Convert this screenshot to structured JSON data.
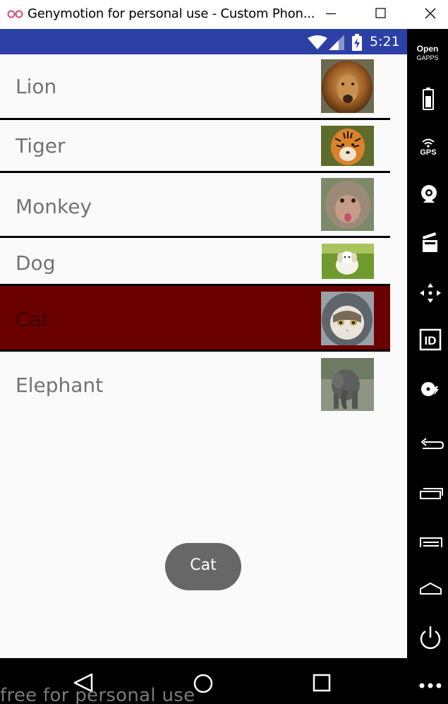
{
  "window": {
    "title": "Genymotion for personal use - Custom Phon...",
    "logo_icon": "genymotion-logo-icon",
    "controls": [
      "minimize-icon",
      "maximize-icon",
      "close-icon"
    ]
  },
  "statusbar": {
    "time": "5:21",
    "icons": [
      "wifi-icon",
      "signal-icon",
      "battery-charging-icon"
    ],
    "color": "#2c3fa5"
  },
  "list": {
    "items": [
      {
        "label": "Lion",
        "image": "lion-image"
      },
      {
        "label": "Tiger",
        "image": "tiger-image"
      },
      {
        "label": "Monkey",
        "image": "monkey-image"
      },
      {
        "label": "Dog",
        "image": "dog-image"
      },
      {
        "label": "Cat",
        "image": "cat-image",
        "selected": true
      },
      {
        "label": "Elephant",
        "image": "elephant-image"
      }
    ],
    "selected_color": "#6a0000"
  },
  "toast": {
    "text": "Cat"
  },
  "toolbar": {
    "open_gapps_line1": "Open",
    "open_gapps_line2": "GAPPS",
    "gps_label": "GPS",
    "id_label": "ID",
    "icons": [
      "open-gapps-icon",
      "battery-icon",
      "gps-icon",
      "webcam-icon",
      "clapperboard-icon",
      "dpad-icon",
      "id-icon",
      "disk-icon",
      "back-icon",
      "recent-apps-icon",
      "menu-icon",
      "home-icon",
      "power-icon",
      "more-icon"
    ]
  },
  "navbar": {
    "icons": [
      "nav-back-icon",
      "nav-home-icon",
      "nav-recents-icon"
    ]
  },
  "watermark": {
    "text": "free for personal use"
  }
}
